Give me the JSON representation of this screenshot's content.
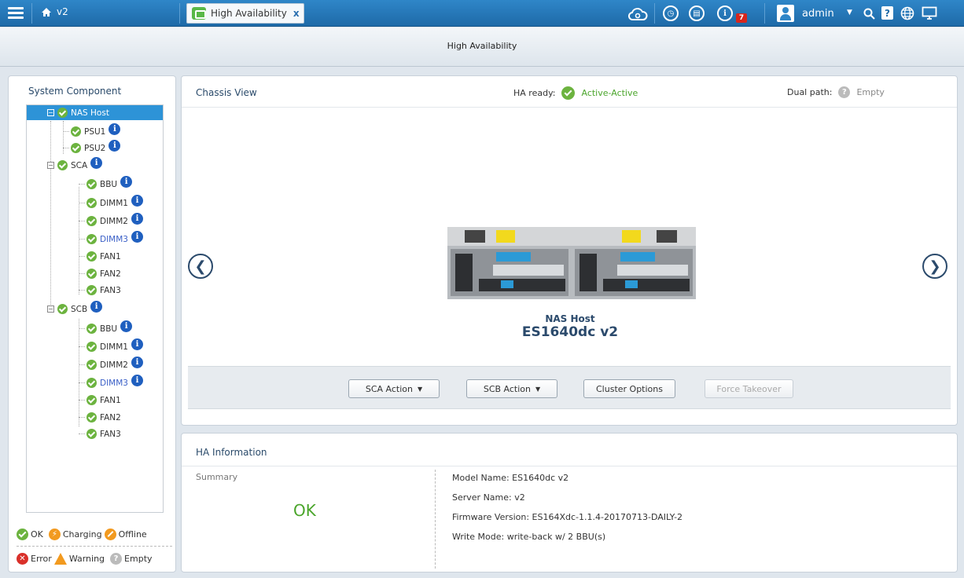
{
  "topbar": {
    "host": "v2",
    "tab_label": "High Availability",
    "tab_close": "x",
    "notification_count": "7",
    "user": "admin"
  },
  "window": {
    "title": "High Availability"
  },
  "tree": {
    "heading": "System Component",
    "nodes": [
      {
        "label": "NAS Host"
      },
      {
        "label": "PSU1"
      },
      {
        "label": "PSU2"
      },
      {
        "label": "SCA"
      },
      {
        "label": "BBU"
      },
      {
        "label": "DIMM1"
      },
      {
        "label": "DIMM2"
      },
      {
        "label": "DIMM3"
      },
      {
        "label": "FAN1"
      },
      {
        "label": "FAN2"
      },
      {
        "label": "FAN3"
      },
      {
        "label": "SCB"
      },
      {
        "label": "BBU"
      },
      {
        "label": "DIMM1"
      },
      {
        "label": "DIMM2"
      },
      {
        "label": "DIMM3"
      },
      {
        "label": "FAN1"
      },
      {
        "label": "FAN2"
      },
      {
        "label": "FAN3"
      }
    ],
    "info_glyph": "i"
  },
  "legend": {
    "ok": "OK",
    "charging": "Charging",
    "offline": "Offline",
    "error": "Error",
    "warning": "Warning",
    "empty": "Empty"
  },
  "chassis": {
    "title": "Chassis View",
    "ha_ready_label": "HA ready:",
    "ha_ready_value": "Active-Active",
    "dual_path_label": "Dual path:",
    "dual_path_value": "Empty",
    "device_name": "NAS Host",
    "device_model": "ES1640dc v2",
    "buttons": {
      "sca_action": "SCA Action",
      "scb_action": "SCB Action",
      "cluster_options": "Cluster Options",
      "force_takeover": "Force Takeover"
    }
  },
  "ha_info": {
    "title": "HA Information",
    "summary_label": "Summary",
    "summary_status": "OK",
    "model_name": "Model Name: ES1640dc v2",
    "server_name": "Server Name: v2",
    "firmware": "Firmware Version: ES164Xdc-1.1.4-20170713-DAILY-2",
    "write_mode": "Write Mode: write-back w/ 2 BBU(s)"
  },
  "colors": {
    "accent": "#2f86c8",
    "ok": "#6cb33f",
    "warn": "#f29a1f",
    "error": "#d9302a"
  }
}
